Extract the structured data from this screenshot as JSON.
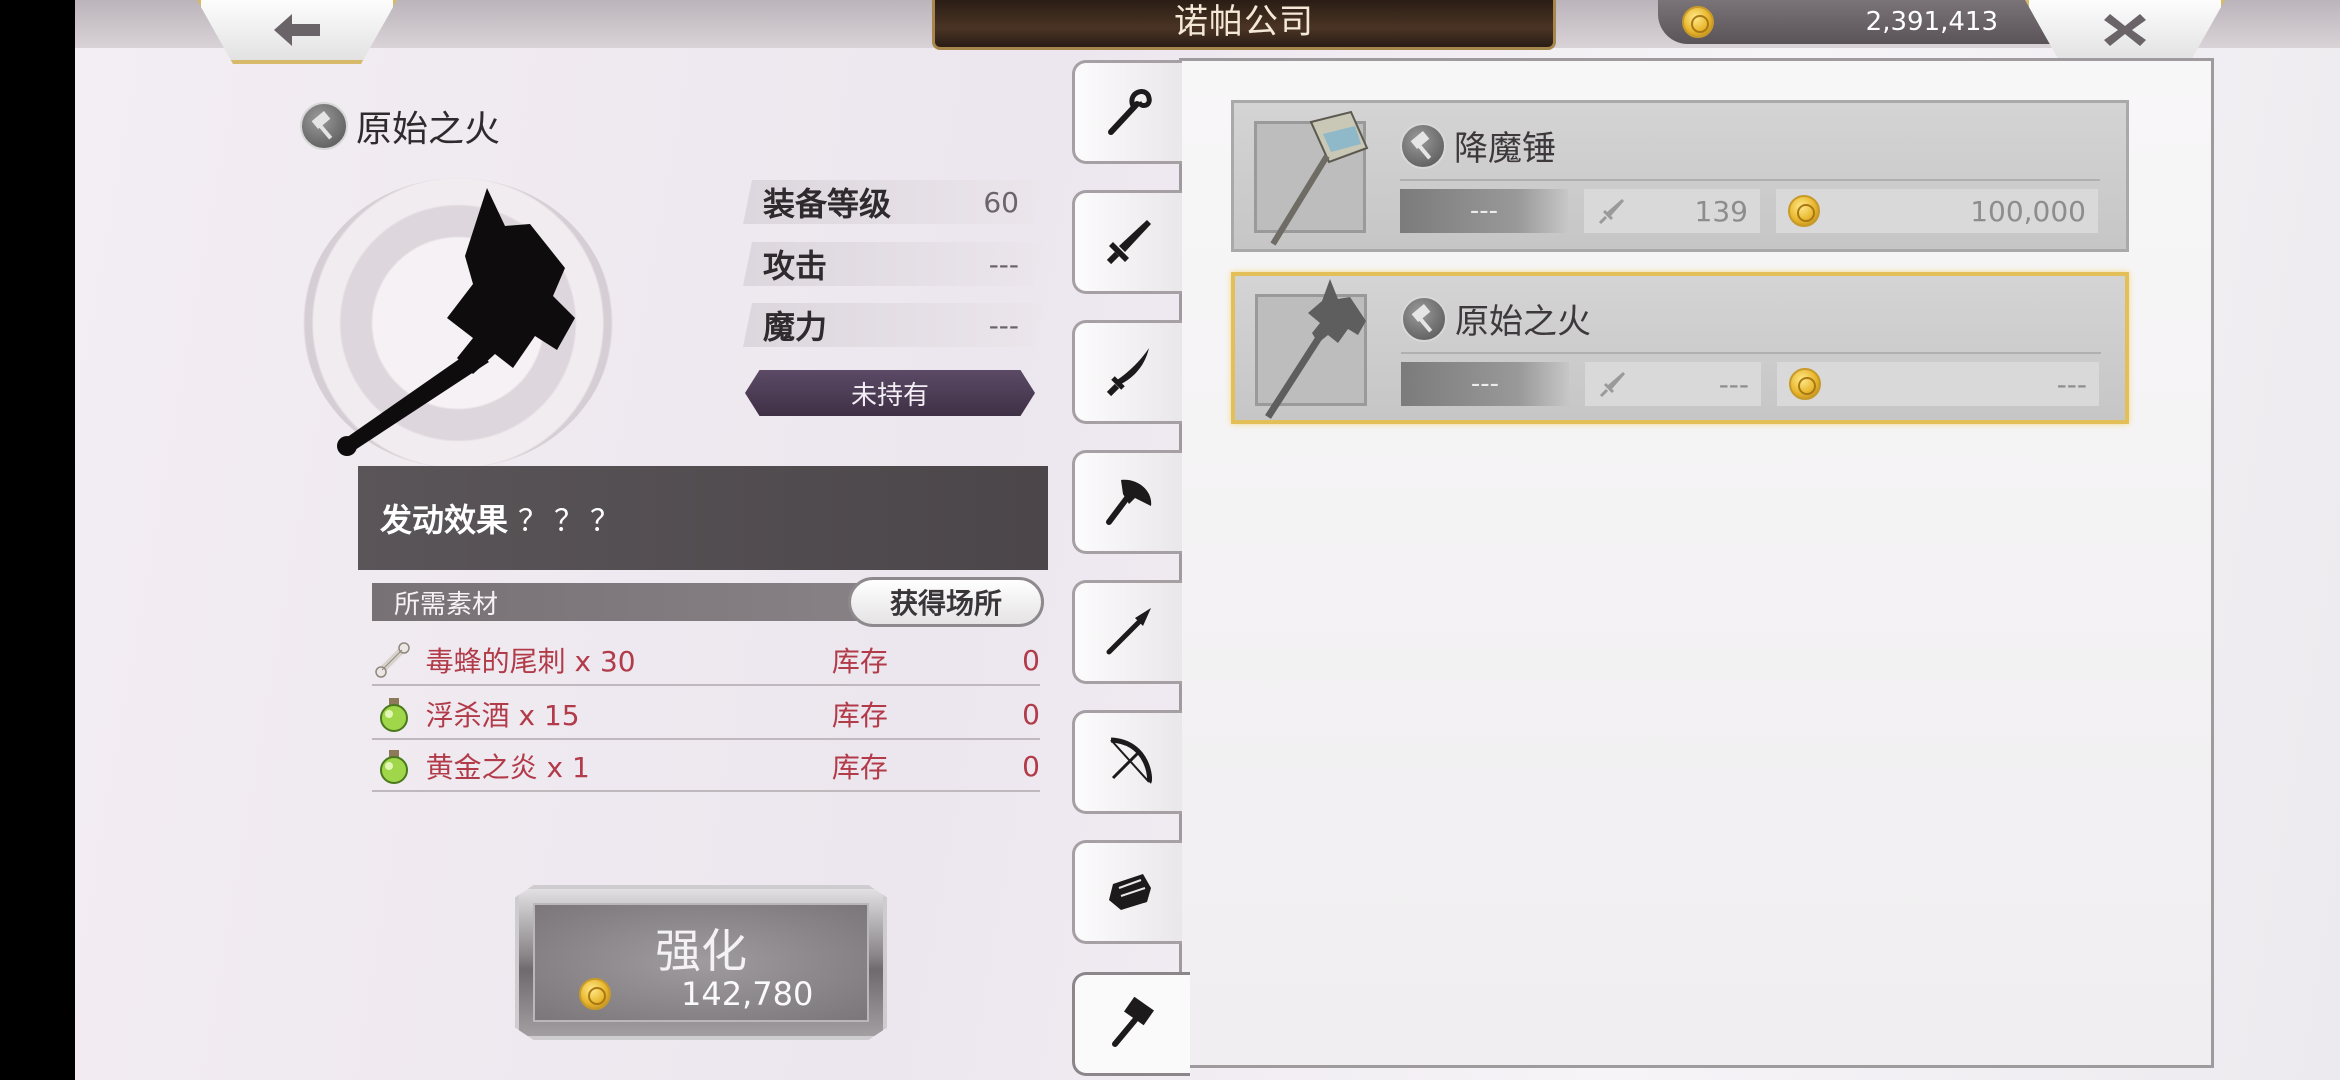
{
  "header": {
    "title": "诺帕公司",
    "currency_amount": "2,391,413"
  },
  "detail": {
    "item_name": "原始之火",
    "stats": [
      {
        "label": "装备等级",
        "value": "60"
      },
      {
        "label": "攻击",
        "value": "---"
      },
      {
        "label": "魔力",
        "value": "---"
      }
    ],
    "status": "未持有",
    "effect_label": "发动效果",
    "effect_value": "？？？",
    "materials_label": "所需素材",
    "source_button": "获得场所",
    "materials": [
      {
        "name": "毒蜂的尾刺 x 30",
        "stock_label": "库存",
        "stock": "0",
        "icon": "bone-icon"
      },
      {
        "name": "浮杀酒 x 15",
        "stock_label": "库存",
        "stock": "0",
        "icon": "potion-icon"
      },
      {
        "name": "黄金之炎 x 1",
        "stock_label": "库存",
        "stock": "0",
        "icon": "potion-icon"
      }
    ],
    "enhance_label": "强化",
    "enhance_cost": "142,780"
  },
  "categories": [
    "staff-icon",
    "sword-icon",
    "blade-icon",
    "axe-icon",
    "spear-icon",
    "bow-icon",
    "gauntlet-icon",
    "hammer-icon"
  ],
  "active_category": "hammer-icon",
  "list": [
    {
      "name": "降魔锤",
      "level": "---",
      "attack": "139",
      "price": "100,000",
      "selected": false
    },
    {
      "name": "原始之火",
      "level": "---",
      "attack": "---",
      "price": "---",
      "selected": true
    }
  ],
  "colors": {
    "accent_gold": "#e2bf57",
    "material_red": "#b23b4a",
    "status_purple": "#4a3a52"
  }
}
